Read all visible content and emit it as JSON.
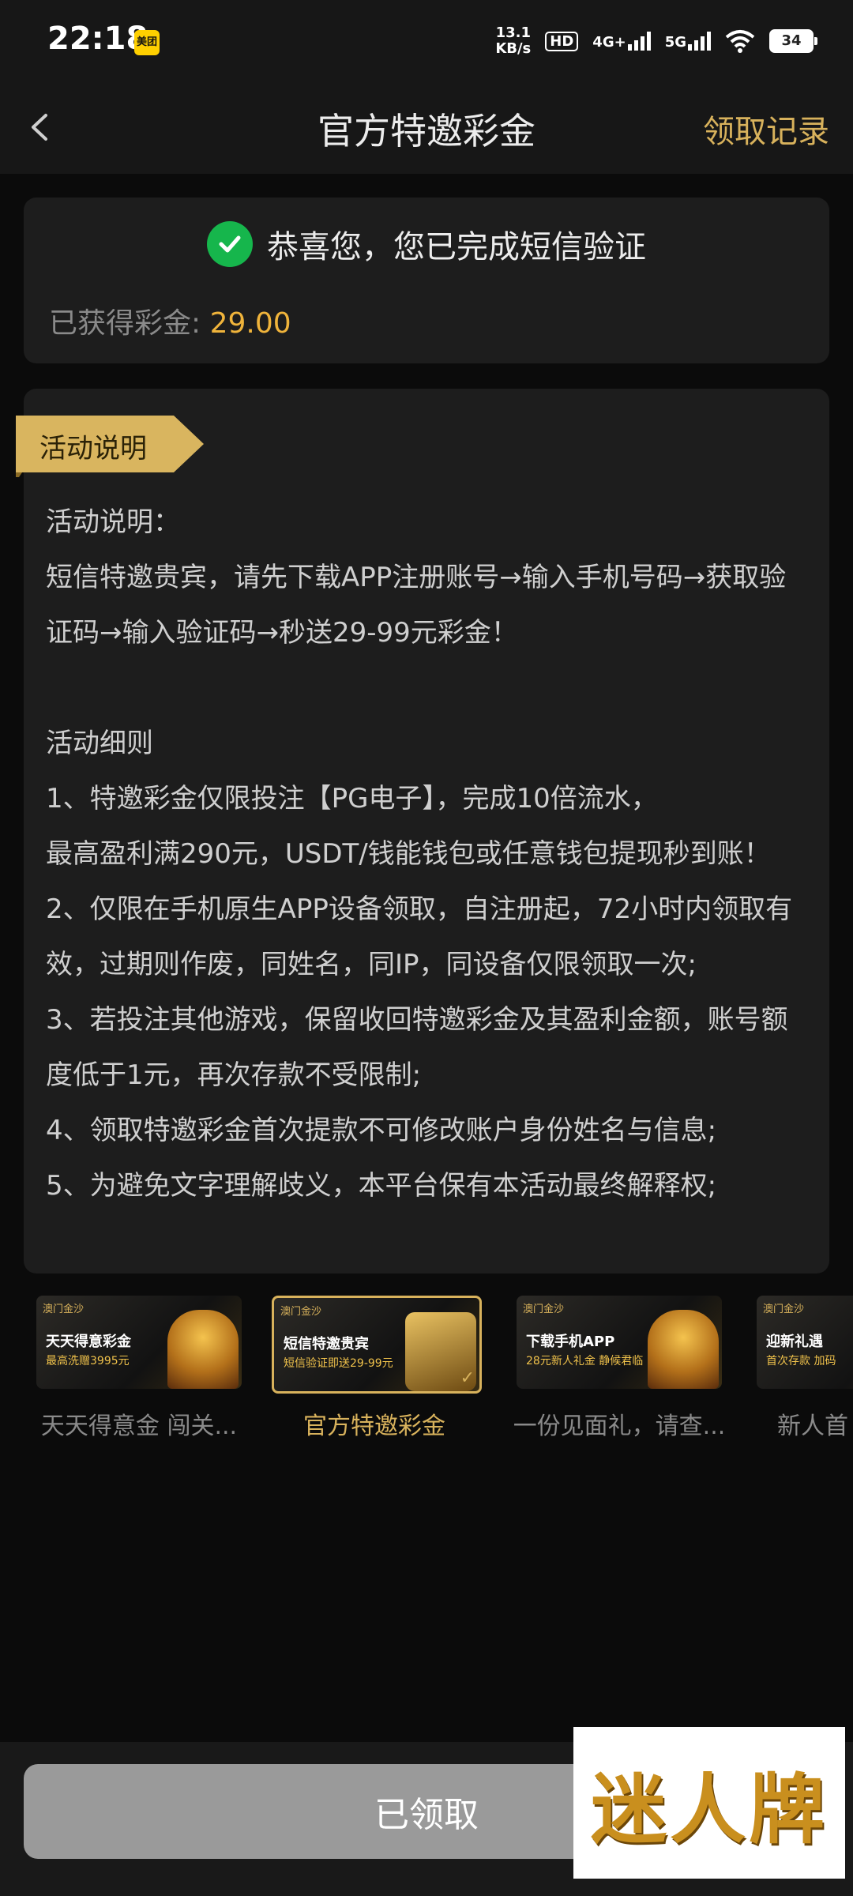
{
  "status_bar": {
    "time": "22:18",
    "app_badge": "美团",
    "net_speed_value": "13.1",
    "net_speed_unit": "KB/s",
    "hd": "HD",
    "sig1": "4G+",
    "sig2": "5G",
    "battery": "34"
  },
  "header": {
    "title": "官方特邀彩金",
    "records_label": "领取记录"
  },
  "success": {
    "message": "恭喜您，您已完成短信验证",
    "earned_label": "已获得彩金:",
    "earned_amount": "29.00"
  },
  "description": {
    "ribbon": "活动说明",
    "lines": [
      "活动说明：",
      "短信特邀贵宾，请先下载APP注册账号→输入手机号码→获取验证码→输入验证码→秒送29-99元彩金！",
      "",
      "活动细则",
      "1、特邀彩金仅限投注【PG电子】，完成10倍流水，",
      "最高盈利满290元，USDT/钱能钱包或任意钱包提现秒到账！",
      "2、仅限在手机原生APP设备领取，自注册起，72小时内领取有效，过期则作废，同姓名，同IP，同设备仅限领取一次;",
      "3、若投注其他游戏，保留收回特邀彩金及其盈利金额，账号额度低于1元，再次存款不受限制;",
      "4、领取特邀彩金首次提款不可修改账户身份姓名与信息;",
      "5、为避免文字理解歧义，本平台保有本活动最终解释权;"
    ]
  },
  "banners": [
    {
      "logo": "澳门金沙",
      "line1": "天天得意彩金",
      "line2": "最高洗赠3995元",
      "caption": "天天得意金 闯关..."
    },
    {
      "logo": "澳门金沙",
      "line1": "短信特邀贵宾",
      "line2": "短信验证即送29-99元",
      "caption": "官方特邀彩金"
    },
    {
      "logo": "澳门金沙",
      "line1": "下载手机APP",
      "line2": "28元新人礼金 静候君临",
      "caption": "一份见面礼，请查..."
    },
    {
      "logo": "澳门金沙",
      "line1": "迎新礼遇",
      "line2": "首次存款 加码",
      "caption": "新人首"
    }
  ],
  "footer": {
    "claim_button": "已领取",
    "watermark": "迷人牌"
  },
  "colors": {
    "accent_gold": "#d8b25c",
    "amount_orange": "#f0b43b",
    "success_green": "#16b64c"
  }
}
